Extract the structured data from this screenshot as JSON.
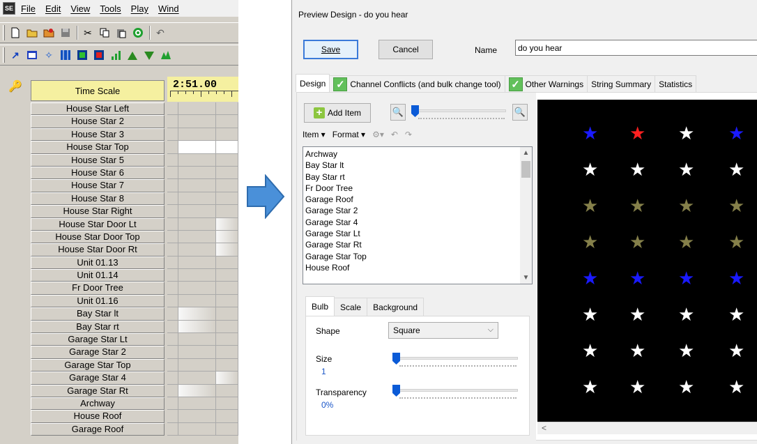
{
  "left_app": {
    "logo": "SE",
    "menu": [
      "File",
      "Edit",
      "View",
      "Tools",
      "Play",
      "Wind"
    ],
    "time_scale_label": "Time Scale",
    "timeline_time": "2:51.00",
    "channels": [
      "House Star Left",
      "House Star 2",
      "House Star 3",
      "House Star Top",
      "House Star 5",
      "House Star 6",
      "House Star 7",
      "House Star 8",
      "House Star Right",
      "House Star Door Lt",
      "House Star Door Top",
      "House Star Door Rt",
      "Unit 01.13",
      "Unit 01.14",
      "Fr Door Tree",
      "Unit 01.16",
      "Bay Star lt",
      "Bay Star rt",
      "Garage Star Lt",
      "Garage Star 2",
      "Garage Star Top",
      "Garage Star 4",
      "Garage Star Rt",
      "Archway",
      "House Roof",
      "Garage Roof"
    ]
  },
  "window": {
    "title": "Preview Design - do you hear",
    "save_label": "Save",
    "cancel_label": "Cancel",
    "name_label": "Name",
    "name_value": "do you hear"
  },
  "tabs": [
    {
      "label": "Design",
      "checked": false
    },
    {
      "label": "Channel Conflicts (and bulk change tool)",
      "checked": true
    },
    {
      "label": "Other Warnings",
      "checked": true
    },
    {
      "label": "String Summary",
      "checked": false
    },
    {
      "label": "Statistics",
      "checked": false
    }
  ],
  "design": {
    "add_item_label": "Add Item",
    "item_menu": "Item",
    "format_menu": "Format",
    "items": [
      "Archway",
      "Bay Star lt",
      "Bay Star rt",
      "Fr Door Tree",
      "Garage Roof",
      "Garage Star 2",
      "Garage Star 4",
      "Garage Star Lt",
      "Garage Star Rt",
      "Garage Star Top",
      "House Roof"
    ],
    "prop_tabs": [
      "Bulb",
      "Scale",
      "Background"
    ],
    "shape_label": "Shape",
    "shape_value": "Square",
    "size_label": "Size",
    "size_value": "1",
    "transparency_label": "Transparency",
    "transparency_value": "0%"
  },
  "preview": {
    "star_rows": [
      [
        "#1a1aff",
        "#ff2020",
        "#ffffff",
        "#1a1aff"
      ],
      [
        "#ffffff",
        "#ffffff",
        "#ffffff",
        "#ffffff"
      ],
      [
        "#85804a",
        "#85804a",
        "#85804a",
        "#85804a"
      ],
      [
        "#85804a",
        "#85804a",
        "#85804a",
        "#85804a"
      ],
      [
        "#1a1aff",
        "#1a1aff",
        "#1a1aff",
        "#1a1aff"
      ],
      [
        "#ffffff",
        "#ffffff",
        "#ffffff",
        "#ffffff"
      ],
      [
        "#ffffff",
        "#ffffff",
        "#ffffff",
        "#ffffff"
      ],
      [
        "#ffffff",
        "#ffffff",
        "#ffffff",
        "#ffffff"
      ]
    ]
  }
}
